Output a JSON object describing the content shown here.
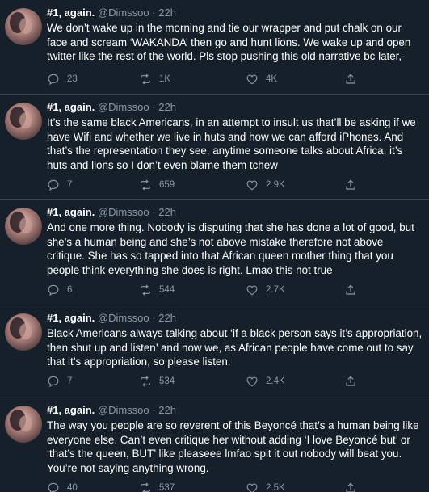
{
  "tweets": [
    {
      "name": "#1, again.",
      "handle": "@Dimssoo",
      "separator": "·",
      "time": "22h",
      "text": "We don’t wake up in the morning and tie our wrapper and put chalk on our face and scream ‘WAKANDA’ then go and hunt lions. We wake up and open twitter like the rest of the world. Pls stop pushing this old narrative bc later,-",
      "replies": "23",
      "retweets": "1K",
      "likes": "4K"
    },
    {
      "name": "#1, again.",
      "handle": "@Dimssoo",
      "separator": "·",
      "time": "22h",
      "text": "It’s the same black Americans, in an attempt to insult us that’ll be asking if we have Wifi and whether we live in huts and how we can afford iPhones. And that’s the representation they see, anytime someone talks about Africa, it’s huts and lions so I don’t even blame them tchew",
      "replies": "7",
      "retweets": "659",
      "likes": "2.9K"
    },
    {
      "name": "#1, again.",
      "handle": "@Dimssoo",
      "separator": "·",
      "time": "22h",
      "text": "And one more thing. Nobody is disputing that she has done a lot of good, but she’s a human being and she’s not above mistake therefore not above critique. She has so tapped into that African queen mother thing that you people think everything she does is right. Lmao this not true",
      "replies": "6",
      "retweets": "544",
      "likes": "2.7K"
    },
    {
      "name": "#1, again.",
      "handle": "@Dimssoo",
      "separator": "·",
      "time": "22h",
      "text": "Black Americans always talking about ‘if a black person says it’s appropriation, then shut up and listen’ and now we, as African people have come out to say that it’s appropriation, so please listen.",
      "replies": "7",
      "retweets": "534",
      "likes": "2.4K"
    },
    {
      "name": "#1, again.",
      "handle": "@Dimssoo",
      "separator": "·",
      "time": "22h",
      "text": "The way you people are so reverent of this Beyoncé that’s a human being like everyone else. Can’t even critique her without adding ‘I love Beyoncé but’ or ‘that’s the queen, BUT’ like pleaseee lmfao spit it out nobody will beat you. You’re not saying anything wrong.",
      "replies": "40",
      "retweets": "537",
      "likes": "2.5K"
    }
  ],
  "icons": {
    "reply": "reply-icon",
    "retweet": "retweet-icon",
    "like": "heart-icon",
    "share": "share-icon"
  },
  "colors": {
    "background": "#15202b",
    "text_primary": "#ffffff",
    "text_secondary": "#8899a6",
    "divider": "#38444d"
  }
}
